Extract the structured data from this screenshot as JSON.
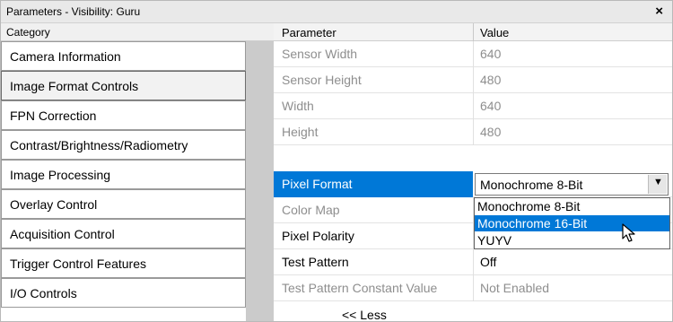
{
  "window": {
    "title": "Parameters - Visibility: Guru",
    "close_glyph": "×"
  },
  "categories": {
    "header": "Category",
    "items": [
      {
        "label": "Camera Information"
      },
      {
        "label": "Image Format Controls",
        "selected": true
      },
      {
        "label": "FPN Correction"
      },
      {
        "label": "Contrast/Brightness/Radiometry"
      },
      {
        "label": "Image Processing"
      },
      {
        "label": "Overlay Control"
      },
      {
        "label": "Acquisition Control"
      },
      {
        "label": "Trigger Control Features"
      },
      {
        "label": "I/O Controls"
      }
    ]
  },
  "parameters": {
    "header_param": "Parameter",
    "header_value": "Value",
    "rows": [
      {
        "name": "Sensor Width",
        "value": "640",
        "disabled": true
      },
      {
        "name": "Sensor Height",
        "value": "480",
        "disabled": true
      },
      {
        "name": "Width",
        "value": "640",
        "disabled": true
      },
      {
        "name": "Height",
        "value": "480",
        "disabled": true
      },
      {
        "name": "Pixel Format",
        "value": "Monochrome 8-Bit",
        "selected": true
      },
      {
        "name": "Color Map",
        "value": "",
        "disabled": true
      },
      {
        "name": "Pixel Polarity",
        "value": ""
      },
      {
        "name": "Test Pattern",
        "value": "Off"
      },
      {
        "name": "Test Pattern Constant Value",
        "value": "Not Enabled",
        "disabled": true
      }
    ],
    "dropdown_arrow": "▼",
    "dropdown_options": [
      "Monochrome 8-Bit",
      "Monochrome 16-Bit",
      "YUYV"
    ],
    "highlighted_option": "Monochrome 16-Bit",
    "less_button": "<< Less"
  },
  "colors": {
    "selection": "#0078d7",
    "gutter": "#cbcbcb",
    "disabled_text": "#8e8e8e"
  }
}
